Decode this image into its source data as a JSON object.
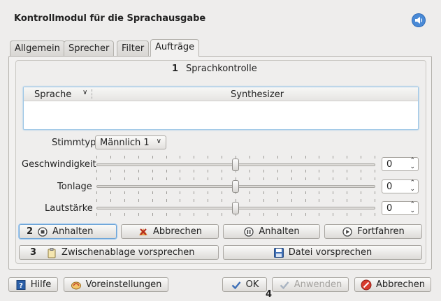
{
  "window": {
    "title": "Kontrollmodul für die Sprachausgabe"
  },
  "tabs": [
    {
      "label": "Allgemein"
    },
    {
      "label": "Sprecher"
    },
    {
      "label": "Filter"
    },
    {
      "label": "Aufträge"
    }
  ],
  "group": {
    "number": "1",
    "title": "Sprachkontrolle"
  },
  "table": {
    "col_language": "Sprache",
    "col_synth": "Synthesizer"
  },
  "voice": {
    "label": "Stimmtyp",
    "value": "Männlich 1"
  },
  "sliders": [
    {
      "label": "Geschwindigkeit",
      "value": "0",
      "level": 0.5
    },
    {
      "label": "Tonlage",
      "value": "0",
      "level": 0.5
    },
    {
      "label": "Lautstärke",
      "value": "0",
      "level": 0.5
    }
  ],
  "row1": {
    "number": "2",
    "pause_label": "Anhalten",
    "cancel_label": "Abbrechen",
    "pause2_label": "Anhalten",
    "resume_label": "Fortfahren"
  },
  "row2": {
    "number": "3",
    "clipboard_label": "Zwischenablage vorsprechen",
    "file_label": "Datei vorsprechen"
  },
  "footer": {
    "help_label": "Hilfe",
    "defaults_label": "Voreinstellungen",
    "ok_label": "OK",
    "apply_label": "Anwenden",
    "cancel_label": "Abbrechen",
    "number": "4"
  }
}
